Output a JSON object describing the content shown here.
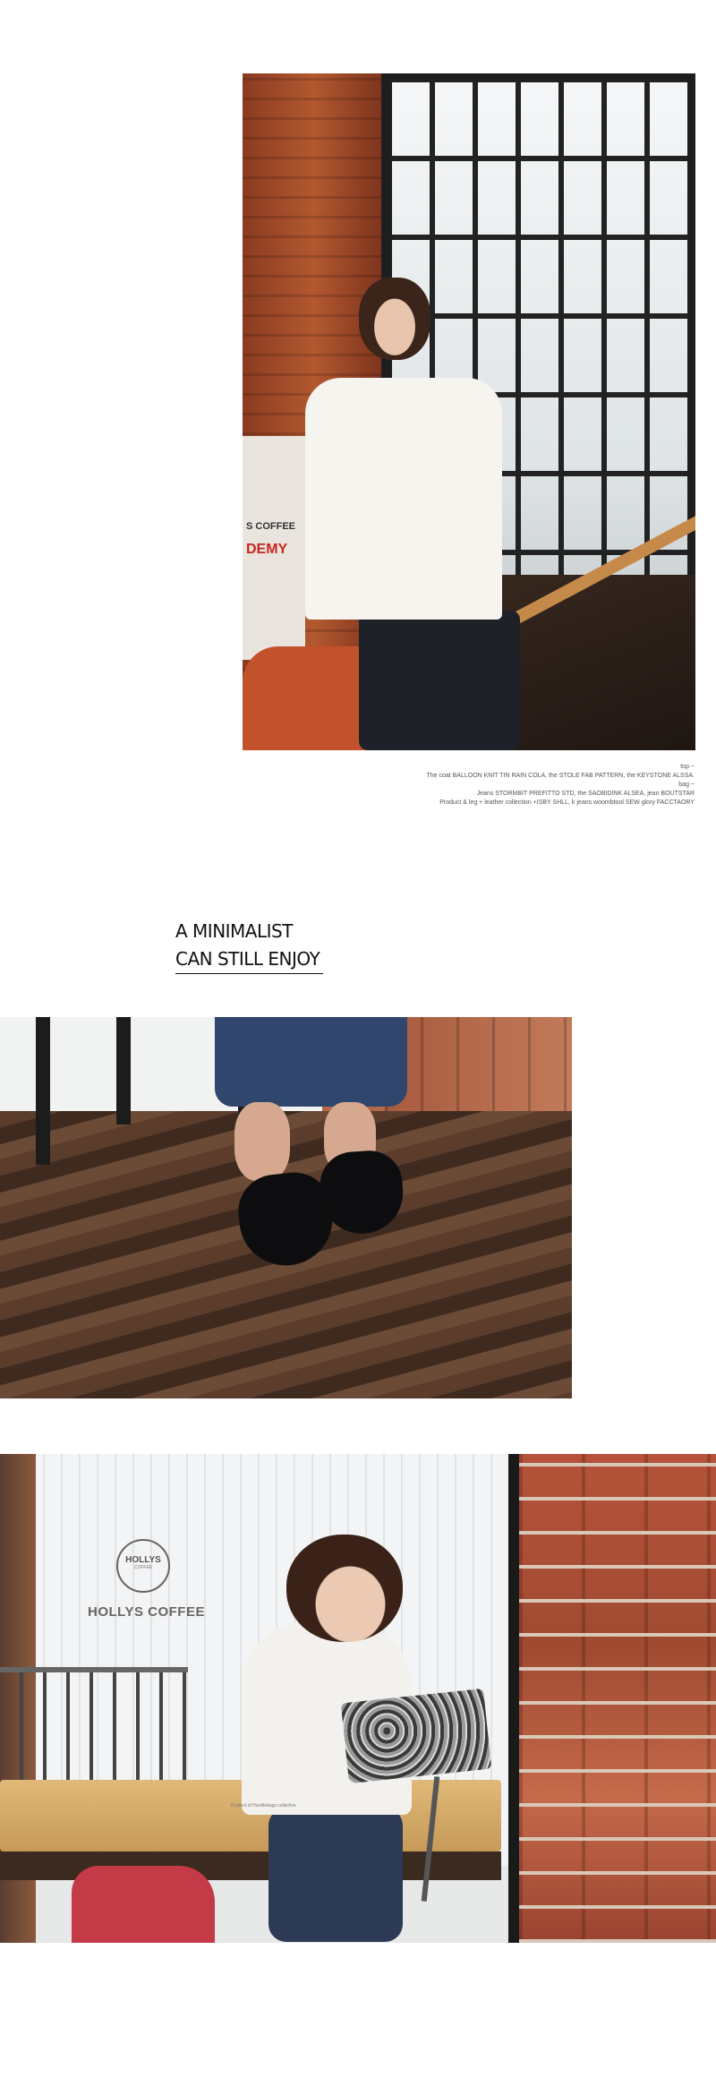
{
  "photo1": {
    "sign_text_1": "S COFFEE",
    "sign_text_2": "DEMY"
  },
  "caption": {
    "line1": "top ~",
    "line2": "The coat BALLOON KNIT TIN RAIN COLA, the STOLE FAB PATTERN, the KEYSTONE ALSSA.",
    "line3": "bag ~",
    "line4": "Jeans STORMBIT PREFITTO STD, the SAOBIDINK ALSEA, jean BOUTSTAR",
    "line5": "Product & leg + leather collection +ISBY SHLL, k jeans woombtool SEW glory FACCTAORY"
  },
  "headline": {
    "line1": "A MINIMALIST",
    "line2": "CAN STILL ENJOY"
  },
  "photo3": {
    "logo_main": "HOLLYS",
    "logo_sub": "COFFEE",
    "wordmark": "HOLLYS COFFEE",
    "tiny_text": "Product of Handlebags collective"
  },
  "colors": {
    "background": "#ffffff",
    "headline_text": "#111111",
    "caption_text": "#555555"
  }
}
